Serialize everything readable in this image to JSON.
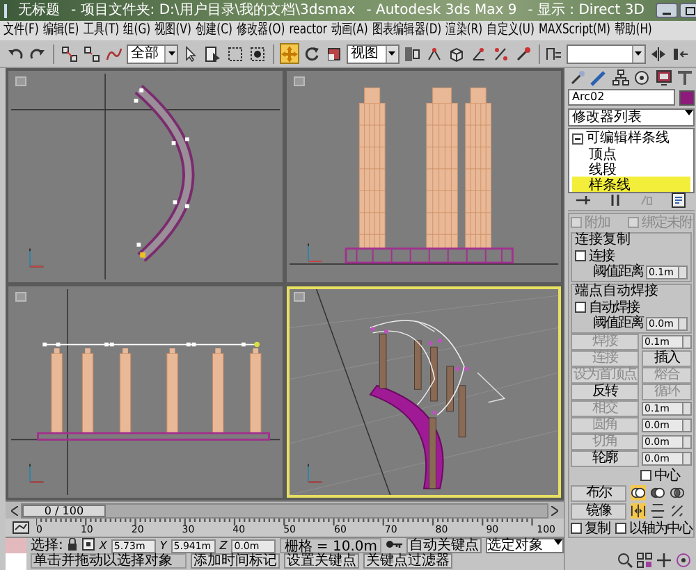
{
  "window": {
    "title_parts": [
      "无标题",
      "- 项目文件夹: D:\\用户目录\\我的文档\\3dsmax",
      "- Autodesk 3ds Max 9",
      "- 显示 : Direct 3D"
    ]
  },
  "menu": [
    "文件(F)",
    "编辑(E)",
    "工具(T)",
    "组(G)",
    "视图(V)",
    "创建(C)",
    "修改器(O)",
    "reactor",
    "动画(A)",
    "图表编辑器(D)",
    "渲染(R)",
    "自定义(U)",
    "MAXScript(M)",
    "帮助(H)"
  ],
  "toolbar": {
    "selection_filter": "全部",
    "reference_coord": "视图",
    "tools": [
      {
        "selected": false
      },
      {
        "selected": false
      },
      {
        "selected": false
      },
      {
        "selected": false
      },
      {
        "selected": false
      },
      {
        "selected": false
      },
      {
        "selected": false
      },
      {
        "selected": false
      },
      {
        "selected": false
      },
      {
        "selected": true
      },
      {
        "selected": false
      },
      {
        "selected": false
      },
      {
        "selected": false
      },
      {
        "selected": false
      },
      {
        "selected": false
      },
      {
        "selected": false
      },
      {
        "selected": false
      },
      {
        "selected": false
      },
      {
        "selected": false
      },
      {
        "selected": false
      },
      {
        "selected": false
      }
    ]
  },
  "viewports": [
    {
      "kind": "top",
      "active": false
    },
    {
      "kind": "front",
      "active": false
    },
    {
      "kind": "left",
      "active": false
    },
    {
      "kind": "perspective",
      "active": true
    }
  ],
  "command_panel": {
    "object": {
      "name": "Arc02",
      "color": "#8e1a7c"
    },
    "modifier_list": "修改器列表",
    "stack": [
      {
        "label": "可编辑样条线",
        "expanded": true,
        "selected": false,
        "children": [
          {
            "label": "顶点",
            "selected": false
          },
          {
            "label": "线段",
            "selected": false
          },
          {
            "label": "样条线",
            "selected": true
          }
        ]
      }
    ],
    "top_checks": [
      {
        "label": "附加",
        "checked": false,
        "disabled": true
      },
      {
        "label": "绑定未附",
        "checked": false,
        "disabled": true
      }
    ],
    "groups": [
      {
        "title": "连接复制",
        "check": {
          "label": "连接",
          "checked": false
        },
        "threshold": {
          "label": "阈值距离",
          "value": "0.1m"
        }
      },
      {
        "title": "端点自动焊接",
        "check": {
          "label": "自动焊接",
          "checked": false
        },
        "threshold": {
          "label": "阈值距离",
          "value": "0.0m"
        }
      }
    ],
    "ops": [
      {
        "kind": "spin",
        "button": {
          "label": "焊接",
          "disabled": true
        },
        "value": "0.1m"
      },
      {
        "kind": "pair",
        "buttons": [
          {
            "label": "连接",
            "disabled": true
          },
          {
            "label": "插入",
            "disabled": false
          }
        ]
      },
      {
        "kind": "pair",
        "buttons": [
          {
            "label": "设为首顶点",
            "disabled": true
          },
          {
            "label": "熔合",
            "disabled": true
          }
        ]
      },
      {
        "kind": "pair",
        "buttons": [
          {
            "label": "反转",
            "disabled": false
          },
          {
            "label": "循环",
            "disabled": true
          }
        ]
      },
      {
        "kind": "spin",
        "button": {
          "label": "相交",
          "disabled": true
        },
        "value": "0.1m"
      },
      {
        "kind": "spin",
        "button": {
          "label": "圆角",
          "disabled": true
        },
        "value": "0.0m"
      },
      {
        "kind": "spin",
        "button": {
          "label": "切角",
          "disabled": true
        },
        "value": "0.0m"
      },
      {
        "kind": "spin",
        "button": {
          "label": "轮廓",
          "disabled": false
        },
        "value": "0.0m"
      }
    ],
    "center_check": {
      "label": "中心",
      "checked": false
    },
    "boolean_label": "布尔",
    "mirror_label": "镜像",
    "bottom_checks": [
      {
        "label": "复制",
        "checked": false
      },
      {
        "label": "以轴为中心",
        "checked": false
      }
    ]
  },
  "time_slider": {
    "position": "0 / 100",
    "level": 0
  },
  "ruler": {
    "labels": [
      "0",
      "10",
      "20",
      "30",
      "40",
      "50",
      "60",
      "70",
      "80",
      "90",
      "100"
    ]
  },
  "status": {
    "selection_label": "选择:",
    "coords": [
      {
        "label": "X",
        "value": "5.73m"
      },
      {
        "label": "Y",
        "value": "5.941m"
      },
      {
        "label": "Z",
        "value": "0.0m"
      }
    ],
    "grid": "栅格 = 10.0m",
    "auto_key": "自动关键点",
    "key_mode": "选定对象",
    "prompt": "单击并拖动以选择对象",
    "time_tag": "添加时间标记",
    "set_key": "设置关键点",
    "key_filters": "关键点过滤器"
  }
}
